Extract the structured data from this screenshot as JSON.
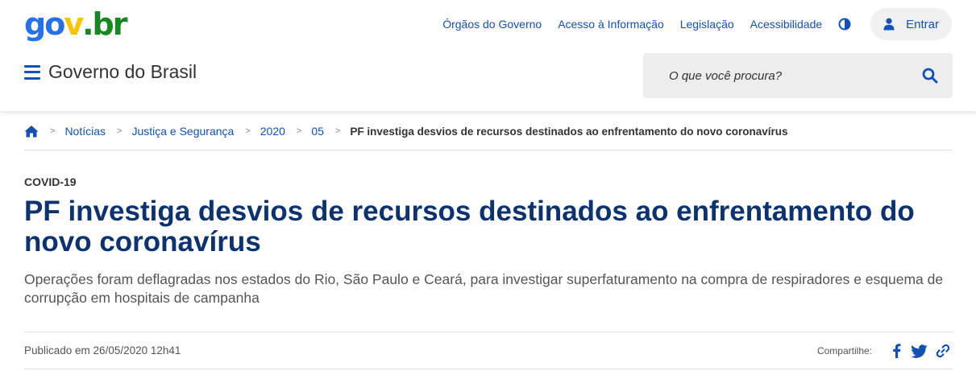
{
  "logo": {
    "parts": [
      "go",
      "v",
      ".br"
    ],
    "colors": [
      "#2670e8",
      "#f8c400",
      "#168821"
    ]
  },
  "header": {
    "links": [
      "Órgãos do Governo",
      "Acesso à Informação",
      "Legislação",
      "Acessibilidade"
    ],
    "contrast_icon": "contrast-icon",
    "login_label": "Entrar",
    "login_icon": "user-icon",
    "site_title": "Governo do Brasil",
    "menu_icon": "hamburger-menu-icon"
  },
  "search": {
    "placeholder": "O que você procura?",
    "icon": "search-icon"
  },
  "breadcrumb": {
    "home_icon": "home-icon",
    "items": [
      "Notícias",
      "Justiça e Segurança",
      "2020",
      "05"
    ],
    "current": "PF investiga desvios de recursos destinados ao enfrentamento do novo coronavírus"
  },
  "article": {
    "tag": "COVID-19",
    "title": "PF investiga desvios de recursos destinados ao enfrentamento do novo coronavírus",
    "subtitle": "Operações foram deflagradas nos estados do Rio, São Paulo e Ceará, para investigar superfaturamento na compra de respiradores e esquema de corrupção em hospitais de campanha",
    "published": "Publicado em 26/05/2020 12h41"
  },
  "share": {
    "label": "Compartilhe:",
    "icons": [
      "facebook-icon",
      "twitter-icon",
      "link-icon"
    ]
  },
  "colors": {
    "primary": "#1351b4",
    "title": "#0c326f",
    "text": "#333333"
  }
}
